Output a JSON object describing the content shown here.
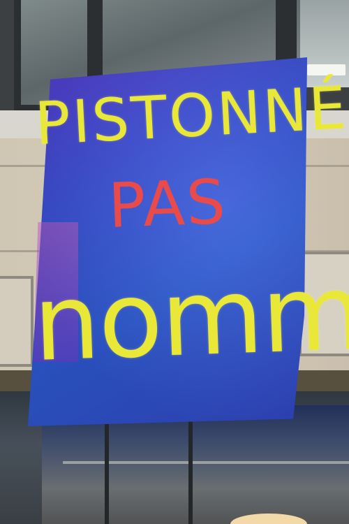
{
  "banner": {
    "line1": "PISTONNÉ",
    "line2": "PAS",
    "line3": "nommÉ"
  },
  "colors": {
    "banner_blue": "#2e5bd6",
    "text_yellow": "#e9e838",
    "text_red": "#e94b4b",
    "wall": "#d6ccb8"
  }
}
